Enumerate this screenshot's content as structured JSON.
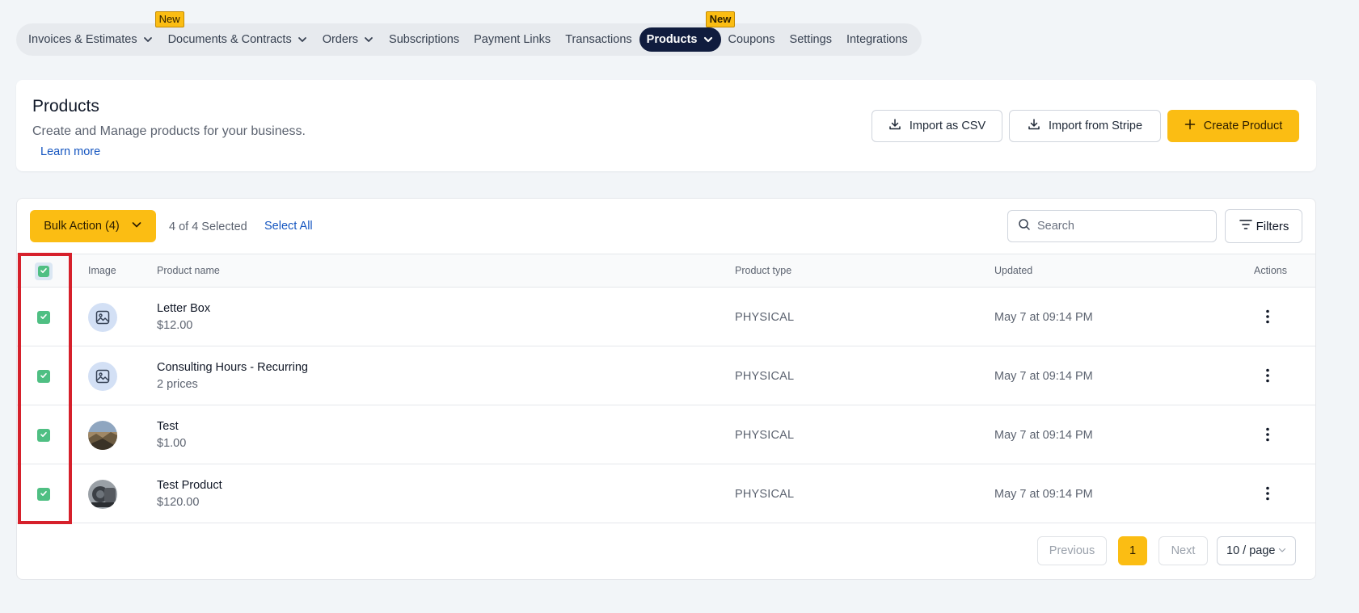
{
  "nav": {
    "items": [
      {
        "label": "Invoices & Estimates",
        "dropdown": true,
        "active": false
      },
      {
        "label": "Documents & Contracts",
        "dropdown": true,
        "active": false,
        "badge": "New"
      },
      {
        "label": "Orders",
        "dropdown": true,
        "active": false
      },
      {
        "label": "Subscriptions",
        "dropdown": false,
        "active": false
      },
      {
        "label": "Payment Links",
        "dropdown": false,
        "active": false
      },
      {
        "label": "Transactions",
        "dropdown": false,
        "active": false
      },
      {
        "label": "Products",
        "dropdown": true,
        "active": true,
        "badge": "New"
      },
      {
        "label": "Coupons",
        "dropdown": false,
        "active": false
      },
      {
        "label": "Settings",
        "dropdown": false,
        "active": false
      },
      {
        "label": "Integrations",
        "dropdown": false,
        "active": false
      }
    ]
  },
  "header": {
    "title": "Products",
    "subtitle": "Create and Manage products for your business.",
    "learn_more": "Learn more",
    "import_csv": "Import as CSV",
    "import_stripe": "Import from Stripe",
    "create_product": "Create Product"
  },
  "toolbar": {
    "bulk_action": "Bulk Action (4)",
    "selected_count": "4 of 4 Selected",
    "select_all": "Select All",
    "search_placeholder": "Search",
    "filters": "Filters"
  },
  "table": {
    "columns": [
      "Image",
      "Product name",
      "Product type",
      "Updated",
      "Actions"
    ],
    "rows": [
      {
        "name": "Letter Box",
        "sub": "$12.00",
        "type": "PHYSICAL",
        "updated": "May 7 at 09:14 PM",
        "image": "placeholder-icon",
        "checked": true
      },
      {
        "name": "Consulting Hours - Recurring",
        "sub": "2 prices",
        "type": "PHYSICAL",
        "updated": "May 7 at 09:14 PM",
        "image": "placeholder-icon",
        "checked": true
      },
      {
        "name": "Test",
        "sub": "$1.00",
        "type": "PHYSICAL",
        "updated": "May 7 at 09:14 PM",
        "image": "photo-landscape",
        "checked": true
      },
      {
        "name": "Test Product",
        "sub": "$120.00",
        "type": "PHYSICAL",
        "updated": "May 7 at 09:14 PM",
        "image": "photo-machine",
        "checked": true
      }
    ]
  },
  "pagination": {
    "previous": "Previous",
    "current": "1",
    "next": "Next",
    "page_size": "10 / page"
  },
  "colors": {
    "accent": "#fbbd13",
    "nav_active": "#101c3e",
    "checkbox": "#4fbf83",
    "link": "#1455c0",
    "highlight": "#d6202b"
  }
}
